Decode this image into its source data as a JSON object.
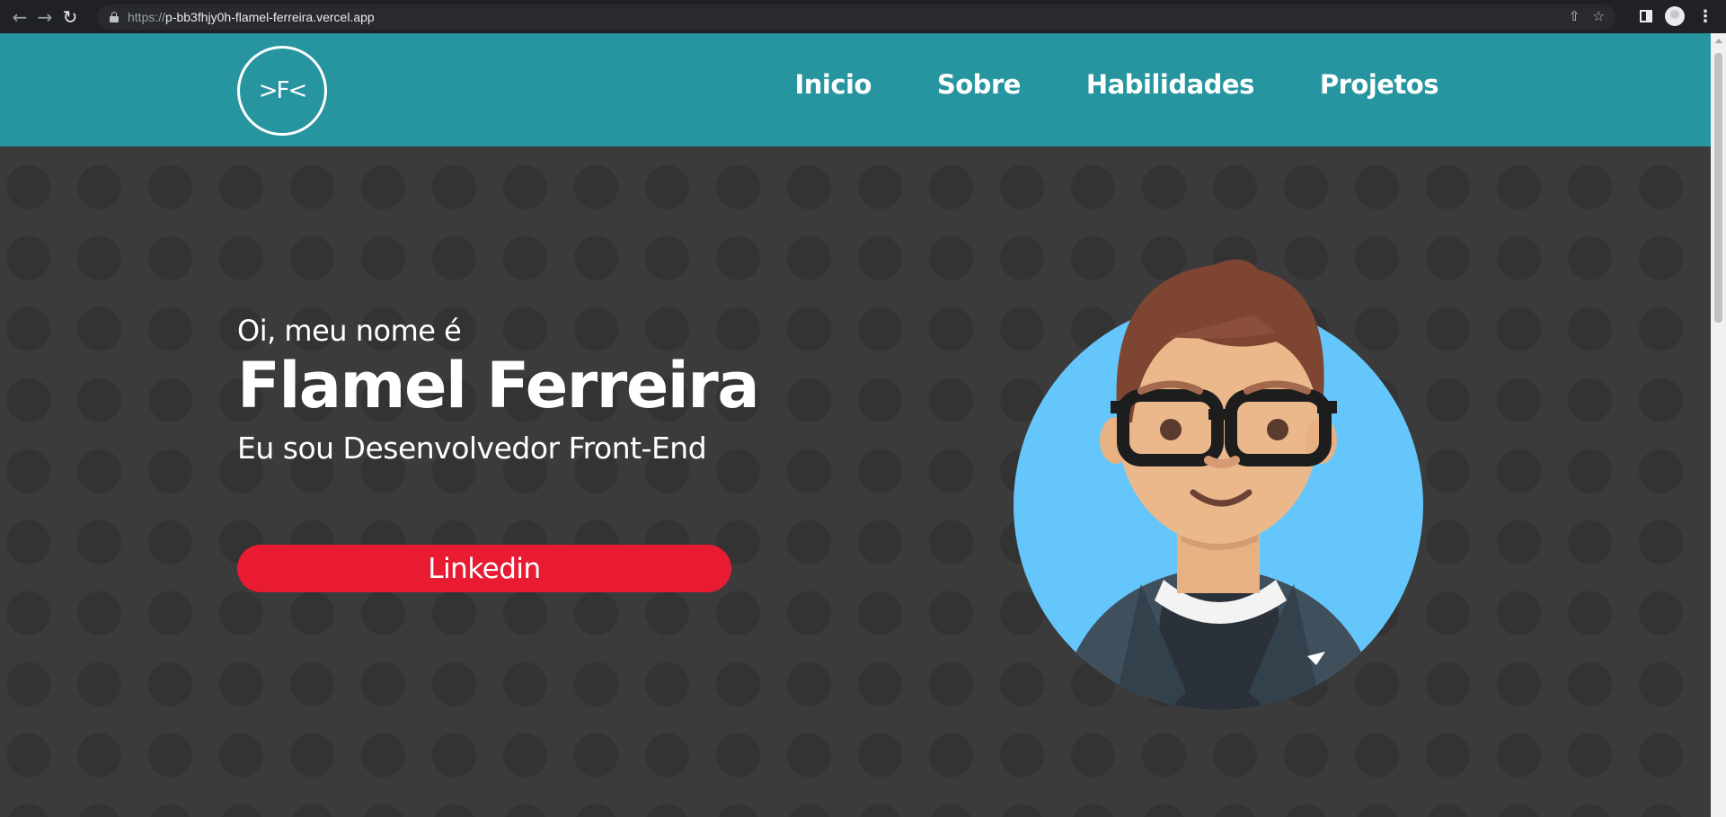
{
  "browser": {
    "url_scheme": "https://",
    "url_host": "p-bb3fhjy0h-flamel-ferreira.vercel.app"
  },
  "header": {
    "logo_text": ">F<",
    "nav": [
      {
        "label": "Inicio"
      },
      {
        "label": "Sobre"
      },
      {
        "label": "Habilidades"
      },
      {
        "label": "Projetos"
      }
    ]
  },
  "hero": {
    "greeting": "Oi, meu nome é",
    "name": "Flamel Ferreira",
    "role": "Eu sou Desenvolvedor Front-End",
    "cta_label": "Linkedin"
  },
  "colors": {
    "header_bg": "#27959f",
    "page_bg": "#3b3b3b",
    "cta_bg": "#e81b33",
    "avatar_circle": "#65c6fb"
  },
  "icons": [
    "back-icon",
    "forward-icon",
    "reload-icon",
    "lock-icon",
    "share-icon",
    "star-icon",
    "side-panel-icon",
    "profile-avatar",
    "menu-icon"
  ]
}
